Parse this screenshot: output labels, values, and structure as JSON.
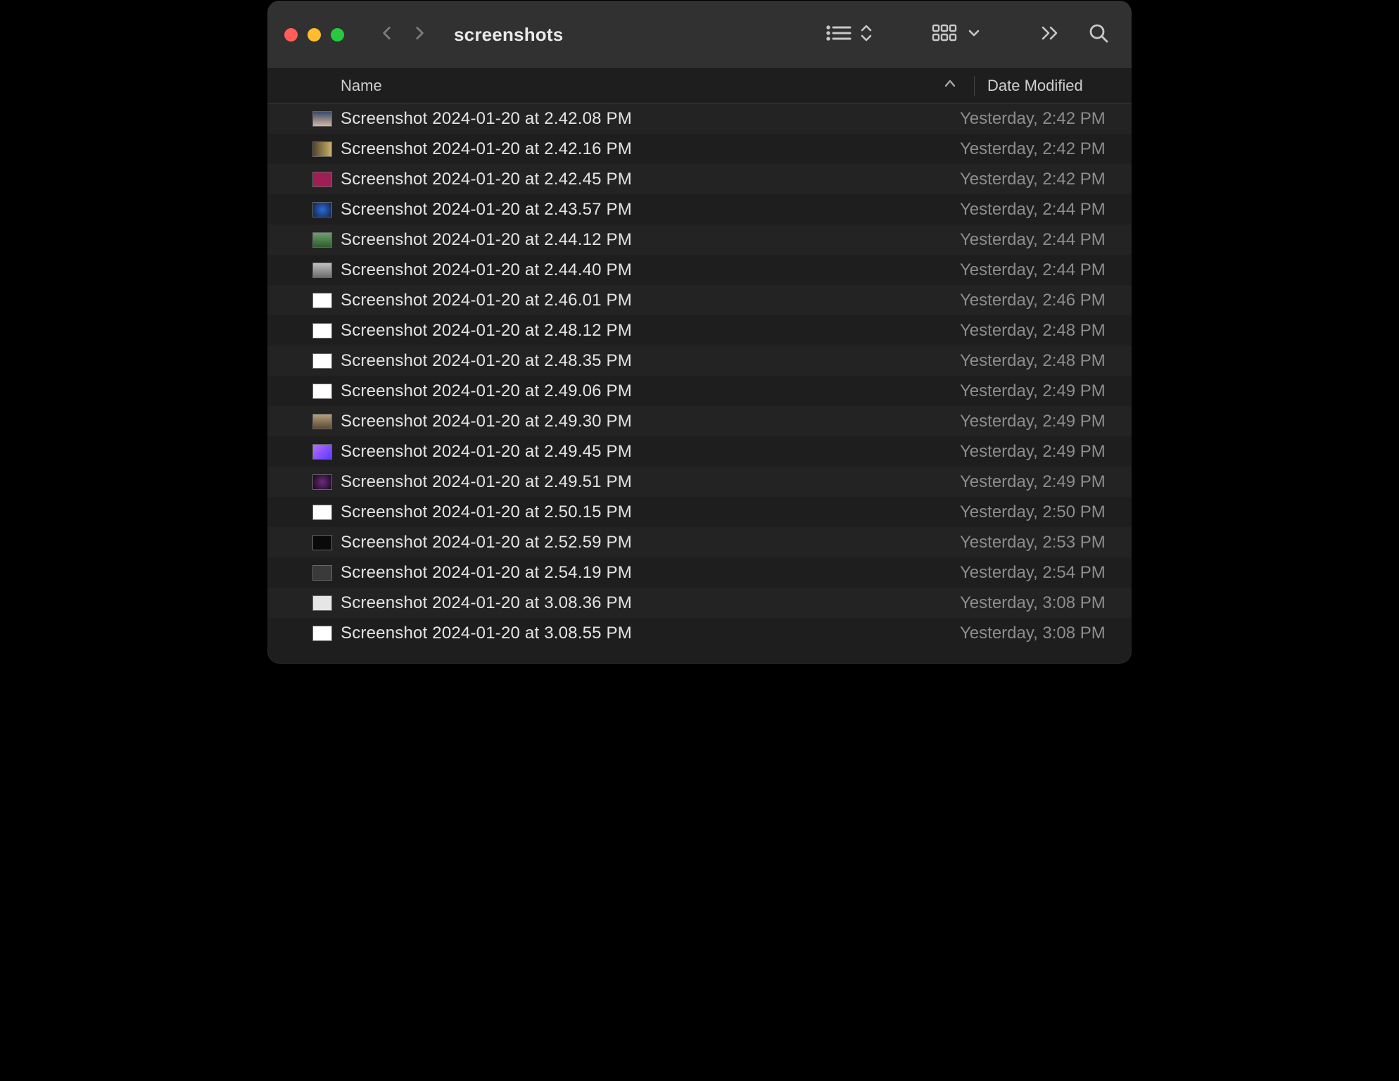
{
  "window": {
    "title": "screenshots"
  },
  "columns": {
    "name": "Name",
    "date": "Date Modified"
  },
  "thumbs": [
    "linear-gradient(#3a4a6a,#d4b6a0)",
    "linear-gradient(90deg,#52452a,#cbb06a)",
    "#9d1f54",
    "radial-gradient(circle,#2c6bd1,#12234a)",
    "linear-gradient(#6aa06a,#2e5e2e)",
    "linear-gradient(#c0c0c0,#6d6d6d)",
    "#ffffff",
    "#ffffff",
    "#ffffff",
    "#ffffff",
    "linear-gradient(#b6a07a,#5a4a36)",
    "linear-gradient(135deg,#b96bff,#5a3bff)",
    "radial-gradient(circle,#6b2d7a,#1a0620)",
    "#ffffff",
    "linear-gradient(#0a0a0a,#0a0a0a)",
    "#3a3a3a",
    "#e6e6e6",
    "#ffffff"
  ],
  "files": [
    {
      "name": "Screenshot 2024-01-20 at 2.42.08 PM",
      "date": "Yesterday, 2:42 PM"
    },
    {
      "name": "Screenshot 2024-01-20 at 2.42.16 PM",
      "date": "Yesterday, 2:42 PM"
    },
    {
      "name": "Screenshot 2024-01-20 at 2.42.45 PM",
      "date": "Yesterday, 2:42 PM"
    },
    {
      "name": "Screenshot 2024-01-20 at 2.43.57 PM",
      "date": "Yesterday, 2:44 PM"
    },
    {
      "name": "Screenshot 2024-01-20 at 2.44.12 PM",
      "date": "Yesterday, 2:44 PM"
    },
    {
      "name": "Screenshot 2024-01-20 at 2.44.40 PM",
      "date": "Yesterday, 2:44 PM"
    },
    {
      "name": "Screenshot 2024-01-20 at 2.46.01 PM",
      "date": "Yesterday, 2:46 PM"
    },
    {
      "name": "Screenshot 2024-01-20 at 2.48.12 PM",
      "date": "Yesterday, 2:48 PM"
    },
    {
      "name": "Screenshot 2024-01-20 at 2.48.35 PM",
      "date": "Yesterday, 2:48 PM"
    },
    {
      "name": "Screenshot 2024-01-20 at 2.49.06 PM",
      "date": "Yesterday, 2:49 PM"
    },
    {
      "name": "Screenshot 2024-01-20 at 2.49.30 PM",
      "date": "Yesterday, 2:49 PM"
    },
    {
      "name": "Screenshot 2024-01-20 at 2.49.45 PM",
      "date": "Yesterday, 2:49 PM"
    },
    {
      "name": "Screenshot 2024-01-20 at 2.49.51 PM",
      "date": "Yesterday, 2:49 PM"
    },
    {
      "name": "Screenshot 2024-01-20 at 2.50.15 PM",
      "date": "Yesterday, 2:50 PM"
    },
    {
      "name": "Screenshot 2024-01-20 at 2.52.59 PM",
      "date": "Yesterday, 2:53 PM"
    },
    {
      "name": "Screenshot 2024-01-20 at 2.54.19 PM",
      "date": "Yesterday, 2:54 PM"
    },
    {
      "name": "Screenshot 2024-01-20 at 3.08.36 PM",
      "date": "Yesterday, 3:08 PM"
    },
    {
      "name": "Screenshot 2024-01-20 at 3.08.55 PM",
      "date": "Yesterday, 3:08 PM"
    }
  ]
}
